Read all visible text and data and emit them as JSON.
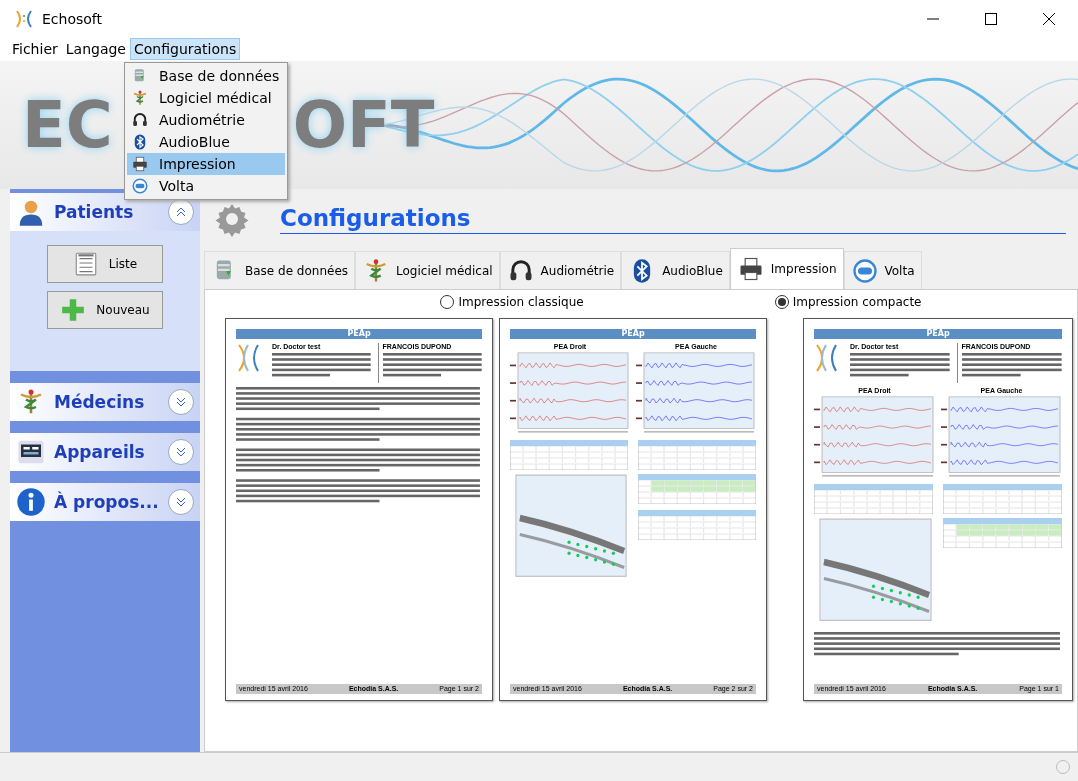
{
  "window": {
    "title": "Echosoft"
  },
  "menu_bar": [
    {
      "label": "Fichier",
      "selected": false
    },
    {
      "label": "Langage",
      "selected": false
    },
    {
      "label": "Configurations",
      "selected": true
    }
  ],
  "dropdown": [
    {
      "label": "Base de données",
      "selected": false
    },
    {
      "label": "Logiciel médical",
      "selected": false
    },
    {
      "label": "Audiométrie",
      "selected": false
    },
    {
      "label": "AudioBlue",
      "selected": false
    },
    {
      "label": "Impression",
      "selected": true
    },
    {
      "label": "Volta",
      "selected": false
    }
  ],
  "banner": {
    "logo_left": "EC",
    "logo_right": "OFT"
  },
  "sidebar": [
    {
      "label": "Patients",
      "expanded": true,
      "children": [
        {
          "label": "Liste"
        },
        {
          "label": "Nouveau"
        }
      ]
    },
    {
      "label": "Médecins",
      "expanded": false
    },
    {
      "label": "Appareils",
      "expanded": false
    },
    {
      "label": "À propos...",
      "expanded": false
    }
  ],
  "page_title": "Configurations",
  "tabs": [
    {
      "label": "Base de données",
      "selected": false
    },
    {
      "label": "Logiciel médical",
      "selected": false
    },
    {
      "label": "Audiométrie",
      "selected": false
    },
    {
      "label": "AudioBlue",
      "selected": false
    },
    {
      "label": "Impression",
      "selected": true
    },
    {
      "label": "Volta",
      "selected": false
    }
  ],
  "print_options": [
    {
      "label": "Impression classique",
      "selected": false
    },
    {
      "label": "Impression compacte",
      "selected": true
    }
  ],
  "previews": [
    {
      "kind": "text",
      "header": "PEAp",
      "doctor": "Dr. Doctor test",
      "patient": "FRANCOIS DUPOND",
      "footer_left": "vendredi 15 avril 2016",
      "footer_center": "Echodia S.A.S.",
      "footer_right": "Page 1 sur 2"
    },
    {
      "kind": "charts",
      "header": "PEAp",
      "chart_titles": [
        "PEA Droit",
        "PEA Gauche"
      ],
      "footer_left": "vendredi 15 avril 2016",
      "footer_center": "Echodia S.A.S.",
      "footer_right": "Page 2 sur 2"
    },
    {
      "kind": "compact",
      "header": "PEAp",
      "doctor": "Dr. Doctor test",
      "patient": "FRANCOIS DUPOND",
      "chart_titles": [
        "PEA Droit",
        "PEA Gauche"
      ],
      "footer_left": "vendredi 15 avril 2016",
      "footer_center": "Echodia S.A.S.",
      "footer_right": "Page 1 sur 1"
    }
  ]
}
